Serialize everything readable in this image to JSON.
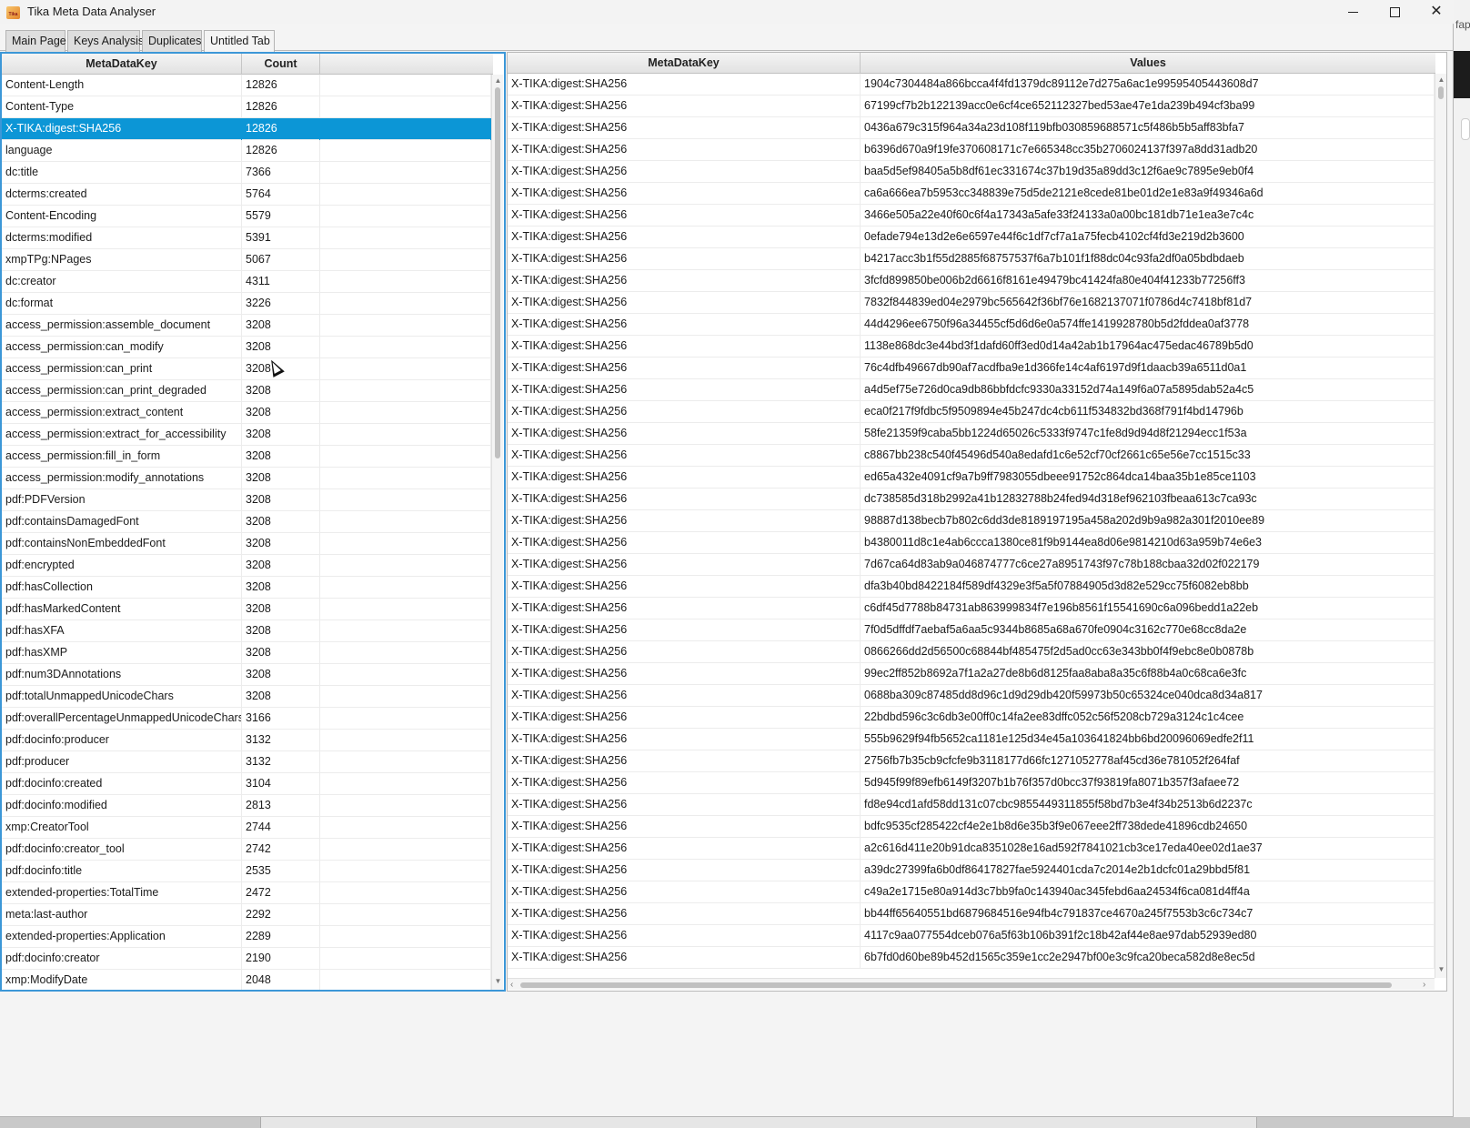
{
  "window": {
    "title": "Tika Meta Data Analyser",
    "app_icon_text": "Tika"
  },
  "tabs": [
    "Main Page",
    "Keys Analysis",
    "Duplicates",
    "Untitled Tab"
  ],
  "background": {
    "peek_text": "fap"
  },
  "left_table": {
    "columns": [
      "MetaDataKey",
      "Count",
      ""
    ],
    "selected_index": 2,
    "rows": [
      [
        "Content-Length",
        "12826"
      ],
      [
        "Content-Type",
        "12826"
      ],
      [
        "X-TIKA:digest:SHA256",
        "12826"
      ],
      [
        "language",
        "12826"
      ],
      [
        "dc:title",
        "7366"
      ],
      [
        "dcterms:created",
        "5764"
      ],
      [
        "Content-Encoding",
        "5579"
      ],
      [
        "dcterms:modified",
        "5391"
      ],
      [
        "xmpTPg:NPages",
        "5067"
      ],
      [
        "dc:creator",
        "4311"
      ],
      [
        "dc:format",
        "3226"
      ],
      [
        "access_permission:assemble_document",
        "3208"
      ],
      [
        "access_permission:can_modify",
        "3208"
      ],
      [
        "access_permission:can_print",
        "3208"
      ],
      [
        "access_permission:can_print_degraded",
        "3208"
      ],
      [
        "access_permission:extract_content",
        "3208"
      ],
      [
        "access_permission:extract_for_accessibility",
        "3208"
      ],
      [
        "access_permission:fill_in_form",
        "3208"
      ],
      [
        "access_permission:modify_annotations",
        "3208"
      ],
      [
        "pdf:PDFVersion",
        "3208"
      ],
      [
        "pdf:containsDamagedFont",
        "3208"
      ],
      [
        "pdf:containsNonEmbeddedFont",
        "3208"
      ],
      [
        "pdf:encrypted",
        "3208"
      ],
      [
        "pdf:hasCollection",
        "3208"
      ],
      [
        "pdf:hasMarkedContent",
        "3208"
      ],
      [
        "pdf:hasXFA",
        "3208"
      ],
      [
        "pdf:hasXMP",
        "3208"
      ],
      [
        "pdf:num3DAnnotations",
        "3208"
      ],
      [
        "pdf:totalUnmappedUnicodeChars",
        "3208"
      ],
      [
        "pdf:overallPercentageUnmappedUnicodeChars",
        "3166"
      ],
      [
        "pdf:docinfo:producer",
        "3132"
      ],
      [
        "pdf:producer",
        "3132"
      ],
      [
        "pdf:docinfo:created",
        "3104"
      ],
      [
        "pdf:docinfo:modified",
        "2813"
      ],
      [
        "xmp:CreatorTool",
        "2744"
      ],
      [
        "pdf:docinfo:creator_tool",
        "2742"
      ],
      [
        "pdf:docinfo:title",
        "2535"
      ],
      [
        "extended-properties:TotalTime",
        "2472"
      ],
      [
        "meta:last-author",
        "2292"
      ],
      [
        "extended-properties:Application",
        "2289"
      ],
      [
        "pdf:docinfo:creator",
        "2190"
      ],
      [
        "xmp:ModifyDate",
        "2048"
      ]
    ]
  },
  "right_table": {
    "columns": [
      "MetaDataKey",
      "Values"
    ],
    "rows": [
      [
        "X-TIKA:digest:SHA256",
        "1904c7304484a866bcca4f4fd1379dc89112e7d275a6ac1e99595405443608d7"
      ],
      [
        "X-TIKA:digest:SHA256",
        "67199cf7b2b122139acc0e6cf4ce652112327bed53ae47e1da239b494cf3ba99"
      ],
      [
        "X-TIKA:digest:SHA256",
        "0436a679c315f964a34a23d108f119bfb030859688571c5f486b5b5aff83bfa7"
      ],
      [
        "X-TIKA:digest:SHA256",
        "b6396d670a9f19fe370608171c7e665348cc35b2706024137f397a8dd31adb20"
      ],
      [
        "X-TIKA:digest:SHA256",
        "baa5d5ef98405a5b8df61ec331674c37b19d35a89dd3c12f6ae9c7895e9eb0f4"
      ],
      [
        "X-TIKA:digest:SHA256",
        "ca6a666ea7b5953cc348839e75d5de2121e8cede81be01d2e1e83a9f49346a6d"
      ],
      [
        "X-TIKA:digest:SHA256",
        "3466e505a22e40f60c6f4a17343a5afe33f24133a0a00bc181db71e1ea3e7c4c"
      ],
      [
        "X-TIKA:digest:SHA256",
        "0efade794e13d2e6e6597e44f6c1df7cf7a1a75fecb4102cf4fd3e219d2b3600"
      ],
      [
        "X-TIKA:digest:SHA256",
        "b4217acc3b1f55d2885f68757537f6a7b101f1f88dc04c93fa2df0a05bdbdaeb"
      ],
      [
        "X-TIKA:digest:SHA256",
        "3fcfd899850be006b2d6616f8161e49479bc41424fa80e404f41233b77256ff3"
      ],
      [
        "X-TIKA:digest:SHA256",
        "7832f844839ed04e2979bc565642f36bf76e1682137071f0786d4c7418bf81d7"
      ],
      [
        "X-TIKA:digest:SHA256",
        "44d4296ee6750f96a34455cf5d6d6e0a574ffe1419928780b5d2fddea0af3778"
      ],
      [
        "X-TIKA:digest:SHA256",
        "1138e868dc3e44bd3f1dafd60ff3ed0d14a42ab1b17964ac475edac46789b5d0"
      ],
      [
        "X-TIKA:digest:SHA256",
        "76c4dfb49667db90af7acdfba9e1d366fe14c4af6197d9f1daacb39a6511d0a1"
      ],
      [
        "X-TIKA:digest:SHA256",
        "a4d5ef75e726d0ca9db86bbfdcfc9330a33152d74a149f6a07a5895dab52a4c5"
      ],
      [
        "X-TIKA:digest:SHA256",
        "eca0f217f9fdbc5f9509894e45b247dc4cb611f534832bd368f791f4bd14796b"
      ],
      [
        "X-TIKA:digest:SHA256",
        "58fe21359f9caba5bb1224d65026c5333f9747c1fe8d9d94d8f21294ecc1f53a"
      ],
      [
        "X-TIKA:digest:SHA256",
        "c8867bb238c540f45496d540a8edafd1c6e52cf70cf2661c65e56e7cc1515c33"
      ],
      [
        "X-TIKA:digest:SHA256",
        "ed65a432e4091cf9a7b9ff7983055dbeee91752c864dca14baa35b1e85ce1103"
      ],
      [
        "X-TIKA:digest:SHA256",
        "dc738585d318b2992a41b12832788b24fed94d318ef962103fbeaa613c7ca93c"
      ],
      [
        "X-TIKA:digest:SHA256",
        "98887d138becb7b802c6dd3de8189197195a458a202d9b9a982a301f2010ee89"
      ],
      [
        "X-TIKA:digest:SHA256",
        "b4380011d8c1e4ab6ccca1380ce81f9b9144ea8d06e9814210d63a959b74e6e3"
      ],
      [
        "X-TIKA:digest:SHA256",
        "7d67ca64d83ab9a046874777c6ce27a8951743f97c78b188cbaa32d02f022179"
      ],
      [
        "X-TIKA:digest:SHA256",
        "dfa3b40bd8422184f589df4329e3f5a5f07884905d3d82e529cc75f6082eb8bb"
      ],
      [
        "X-TIKA:digest:SHA256",
        "c6df45d7788b84731ab863999834f7e196b8561f15541690c6a096bedd1a22eb"
      ],
      [
        "X-TIKA:digest:SHA256",
        "7f0d5dffdf7aebaf5a6aa5c9344b8685a68a670fe0904c3162c770e68cc8da2e"
      ],
      [
        "X-TIKA:digest:SHA256",
        "0866266dd2d56500c68844bf485475f2d5ad0cc63e343bb0f4f9ebc8e0b0878b"
      ],
      [
        "X-TIKA:digest:SHA256",
        "99ec2ff852b8692a7f1a2a27de8b6d8125faa8aba8a35c6f88b4a0c68ca6e3fc"
      ],
      [
        "X-TIKA:digest:SHA256",
        "0688ba309c87485dd8d96c1d9d29db420f59973b50c65324ce040dca8d34a817"
      ],
      [
        "X-TIKA:digest:SHA256",
        "22bdbd596c3c6db3e00ff0c14fa2ee83dffc052c56f5208cb729a3124c1c4cee"
      ],
      [
        "X-TIKA:digest:SHA256",
        "555b9629f94fb5652ca1181e125d34e45a103641824bb6bd20096069edfe2f11"
      ],
      [
        "X-TIKA:digest:SHA256",
        "2756fb7b35cb9cfcfe9b3118177d66fc1271052778af45cd36e781052f264faf"
      ],
      [
        "X-TIKA:digest:SHA256",
        "5d945f99f89efb6149f3207b1b76f357d0bcc37f93819fa8071b357f3afaee72"
      ],
      [
        "X-TIKA:digest:SHA256",
        "fd8e94cd1afd58dd131c07cbc9855449311855f58bd7b3e4f34b2513b6d2237c"
      ],
      [
        "X-TIKA:digest:SHA256",
        "bdfc9535cf285422cf4e2e1b8d6e35b3f9e067eee2ff738dede41896cdb24650"
      ],
      [
        "X-TIKA:digest:SHA256",
        "a2c616d411e20b91dca8351028e16ad592f7841021cb3ce17eda40ee02d1ae37"
      ],
      [
        "X-TIKA:digest:SHA256",
        "a39dc27399fa6b0df86417827fae5924401cda7c2014e2b1dcfc01a29bbd5f81"
      ],
      [
        "X-TIKA:digest:SHA256",
        "c49a2e1715e80a914d3c7bb9fa0c143940ac345febd6aa24534f6ca081d4ff4a"
      ],
      [
        "X-TIKA:digest:SHA256",
        "bb44ff65640551bd6879684516e94fb4c791837ce4670a245f7553b3c6c734c7"
      ],
      [
        "X-TIKA:digest:SHA256",
        "4117c9aa077554dceb076a5f63b106b391f2c18b42af44e8ae97dab52939ed80"
      ],
      [
        "X-TIKA:digest:SHA256",
        "6b7fd0d60be89b452d1565c359e1cc2e2947bf00e3c9fca20beca582d8e8ec5d"
      ]
    ]
  }
}
